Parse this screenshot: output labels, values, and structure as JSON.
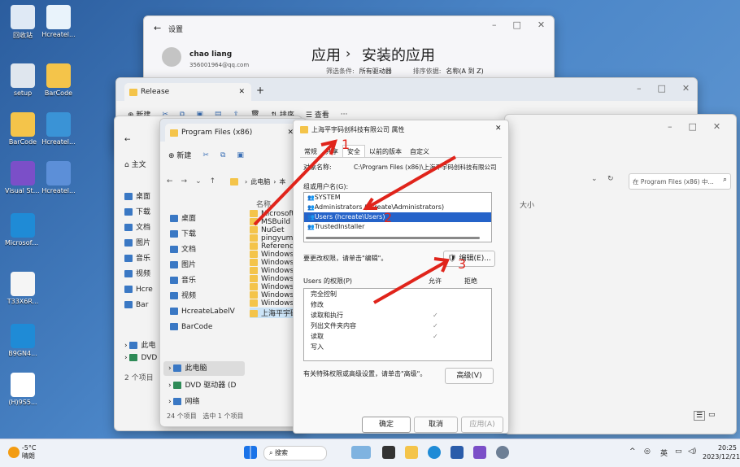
{
  "desktop": {
    "icons": [
      {
        "label": "回收站",
        "icon": "recycle-bin-icon",
        "color": "#dfe9f5"
      },
      {
        "label": "Hcreatel...",
        "icon": "app-icon",
        "color": "#e9f3fb"
      },
      {
        "label": "setup",
        "icon": "setup-icon",
        "color": "#dfe6ee"
      },
      {
        "label": "BarCode",
        "icon": "folder-icon",
        "color": "#f4c44a"
      },
      {
        "label": "BarCode",
        "icon": "folder-icon",
        "color": "#f4c44a"
      },
      {
        "label": "Hcreatel...",
        "icon": "app-icon",
        "color": "#3a93d6"
      },
      {
        "label": "Visual Studio 2022",
        "icon": "visual-studio-icon",
        "color": "#7b4fc8"
      },
      {
        "label": "Hcreatel...",
        "icon": "app-icon",
        "color": "#5c8fd8"
      },
      {
        "label": "Microsoft Edge",
        "icon": "edge-icon",
        "color": "#1f8bd6"
      },
      {
        "label": "T33X6R...",
        "icon": "file-icon",
        "color": "#f5f5f5"
      },
      {
        "label": "B9GN4...",
        "icon": "edge-icon",
        "color": "#1f8bd6"
      },
      {
        "label": "(H)9S5...",
        "icon": "qr-icon",
        "color": "#ffffff"
      }
    ]
  },
  "settings": {
    "back": "←",
    "title": "设置",
    "user_name": "chao liang",
    "user_email": "356001964@qq.com",
    "breadcrumb_1": "应用",
    "breadcrumb_sep": "›",
    "breadcrumb_2": "安装的应用",
    "filter_label": "筛选条件:",
    "filter_value": "所有驱动器",
    "sort_label": "排序依据:",
    "sort_value": "名称(A 到 Z)"
  },
  "release": {
    "tab": "Release",
    "new": "新建",
    "sort": "排序",
    "view": "查看",
    "more": "···",
    "home_label": "主文"
  },
  "pf": {
    "tab": "Program Files (x86)",
    "new": "新建",
    "path_root": "此电脑",
    "path_next": "本",
    "search_placeholder": "在 Program Files (x86) 中...",
    "col_name": "名称",
    "col_size": "大小",
    "nav_left": [
      "桌面",
      "下载",
      "文档",
      "图片",
      "音乐",
      "视频",
      "Hcre",
      "Bar"
    ],
    "nav_quick": [
      "桌面",
      "下载",
      "文档",
      "图片",
      "音乐",
      "视频",
      "HcreateLabelV",
      "BarCode"
    ],
    "nav_pc": "此电脑",
    "nav_dvd": "DVD 驱动器 (D",
    "nav_net": "网络",
    "nav_left_pc": "此电",
    "nav_left_dvd": "DVD",
    "left_status": "2 个项目",
    "files": [
      "Microsoft.N",
      "MSBuild",
      "NuGet",
      "pingyumac",
      "Reference A",
      "Windows D",
      "Windows K",
      "Windows M",
      "Windows M",
      "Windows N",
      "Windows P",
      "WindowsPo",
      "上海平宇码"
    ],
    "status": "24 个项目",
    "status_sel": "选中 1 个项目"
  },
  "props": {
    "title": "上海平宇码创科技有限公司 属性",
    "tabs": [
      "常规",
      "共享",
      "安全",
      "以前的版本",
      "自定义"
    ],
    "object_label": "对象名称:",
    "object_value": "C:\\Program Files (x86)\\上海平宇码创科技有限公司",
    "group_label": "组或用户名(G):",
    "users": [
      "SYSTEM",
      "Administrators (hcreate\\Administrators)",
      "Users (hcreate\\Users)",
      "TrustedInstaller"
    ],
    "change_hint": "要更改权限，请单击\"编辑\"。",
    "edit_btn": "编辑(E)...",
    "perm_label": "Users 的权限(P)",
    "allow": "允许",
    "deny": "拒绝",
    "perms": [
      {
        "name": "完全控制",
        "allow": ""
      },
      {
        "name": "修改",
        "allow": ""
      },
      {
        "name": "读取和执行",
        "allow": "✓"
      },
      {
        "name": "列出文件夹内容",
        "allow": "✓"
      },
      {
        "name": "读取",
        "allow": "✓"
      },
      {
        "name": "写入",
        "allow": ""
      }
    ],
    "adv_hint": "有关特殊权限或高级设置，请单击\"高级\"。",
    "adv_btn": "高级(V)",
    "ok": "确定",
    "cancel": "取消",
    "apply": "应用(A)",
    "close": "✕"
  },
  "annotations": {
    "one": "1",
    "two": "2",
    "three": "3"
  },
  "taskbar": {
    "weather_temp": "-5°C",
    "weather_desc": "晴朗",
    "search": "搜索",
    "lang": "英",
    "time": "20:25",
    "date": "2023/12/21"
  }
}
